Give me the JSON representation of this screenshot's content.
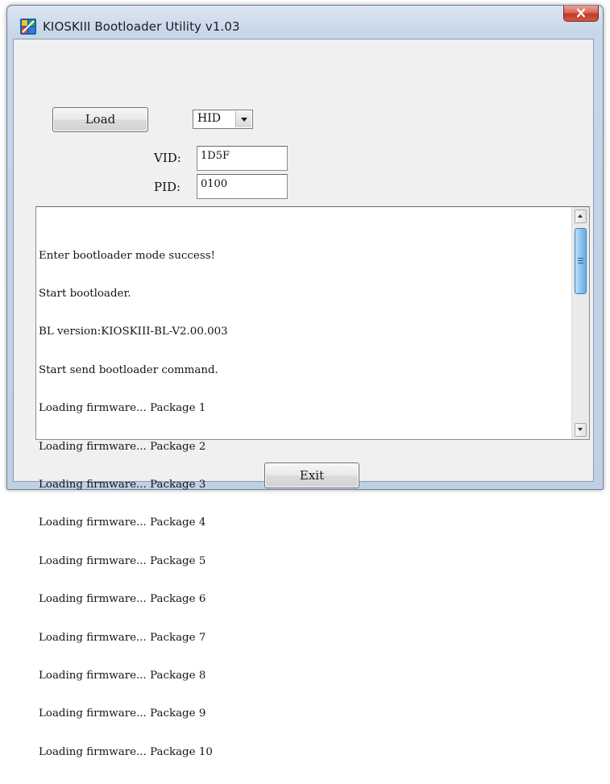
{
  "window": {
    "title": "KIOSKIII Bootloader Utility v1.03",
    "close_label": "x"
  },
  "controls": {
    "load_label": "Load",
    "interface_selected": "HID",
    "vid_label": "VID:",
    "vid_value": "1D5F",
    "pid_label": "PID:",
    "pid_value": "0100",
    "exit_label": "Exit"
  },
  "log": {
    "lines": [
      "Enter bootloader mode success!",
      "Start bootloader.",
      "BL version:KIOSKIII-BL-V2.00.003",
      "Start send bootloader command.",
      "Loading firmware... Package 1",
      "Loading firmware... Package 2",
      "Loading firmware... Package 3",
      "Loading firmware... Package 4",
      "Loading firmware... Package 5",
      "Loading firmware... Package 6",
      "Loading firmware... Package 7",
      "Loading firmware... Package 8",
      "Loading firmware... Package 9",
      "Loading firmware... Package 10"
    ]
  },
  "icons": {
    "app": "kiosk-app-icon",
    "close": "close-icon",
    "dropdown": "chevron-down-icon",
    "scroll_up": "arrow-up-icon",
    "scroll_down": "arrow-down-icon"
  },
  "colors": {
    "close_button": "#c94434",
    "scroll_thumb": "#8ec4f0",
    "window_frame": "#c7d6e9"
  }
}
